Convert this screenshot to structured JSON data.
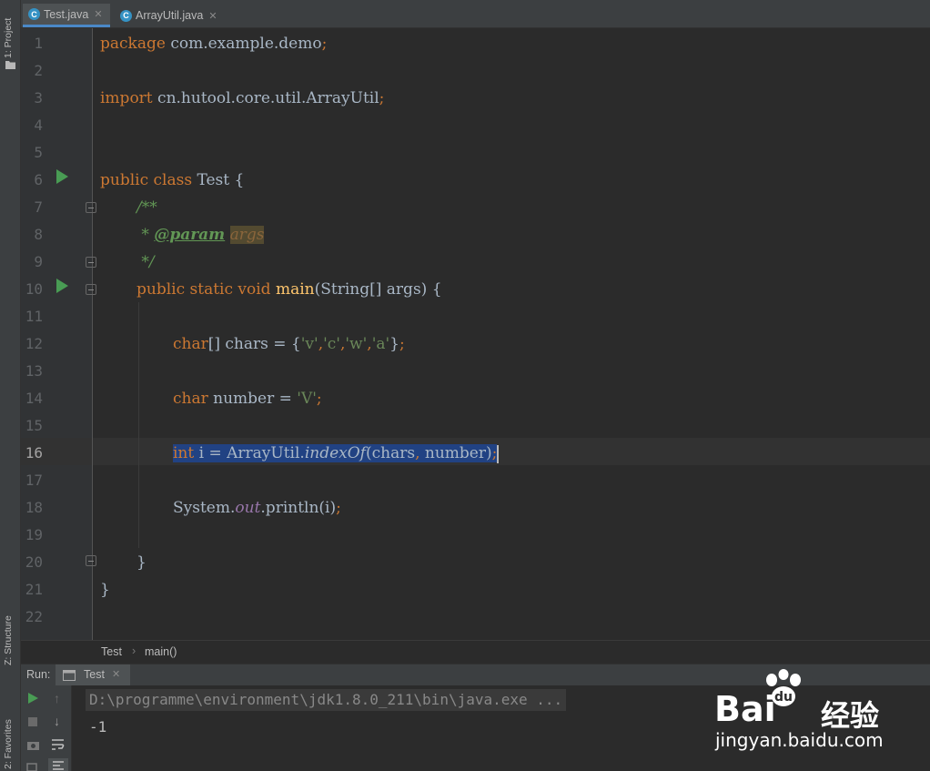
{
  "sidebar": {
    "project_tab": "1: Project",
    "structure_tab": "Z: Structure",
    "favorites_tab": "2: Favorites"
  },
  "tabs": [
    {
      "label": "Test.java",
      "icon": "java-class-icon",
      "active": true
    },
    {
      "label": "ArrayUtil.java",
      "icon": "java-class-icon",
      "active": false
    }
  ],
  "editor": {
    "line_numbers": [
      "1",
      "2",
      "3",
      "4",
      "5",
      "6",
      "7",
      "8",
      "9",
      "10",
      "11",
      "12",
      "13",
      "14",
      "15",
      "16",
      "17",
      "18",
      "19",
      "20",
      "21",
      "22"
    ],
    "current_line": 16,
    "code": {
      "l1_kw": "package",
      "l1_rest": " com.example.demo",
      "l1_semi": ";",
      "l3_kw": "import",
      "l3_rest": " cn.hutool.core.util.ArrayUtil",
      "l3_semi": ";",
      "l6_kw": "public class",
      "l6_rest": " Test {",
      "l7": "/**",
      "l8_star": " * ",
      "l8_tag": "@param",
      "l8_sp": " ",
      "l8_param": "args",
      "l9": " */",
      "l10_kw": "public static void",
      "l10_sp": " ",
      "l10_fn": "main",
      "l10_rest": "(String[] args) {",
      "l12_kw": "char",
      "l12_a": "[] chars = {",
      "l12_s1": "'v'",
      "l12_c1": ",",
      "l12_s2": "'c'",
      "l12_c2": ",",
      "l12_s3": "'w'",
      "l12_c3": ",",
      "l12_s4": "'a'",
      "l12_end": "}",
      "l12_semi": ";",
      "l14_kw": "char",
      "l14_a": " number = ",
      "l14_s": "'V'",
      "l14_semi": ";",
      "l16_kw": "int",
      "l16_a": " i = ArrayUtil.",
      "l16_m": "indexOf",
      "l16_b": "(chars",
      "l16_comma": ",",
      "l16_c": " number)",
      "l16_semi": ";",
      "l18_a": "System.",
      "l18_field": "out",
      "l18_b": ".println(i)",
      "l18_semi": ";",
      "l20": "}",
      "l21": "}"
    }
  },
  "breadcrumb": [
    "Test",
    "main()"
  ],
  "run_panel": {
    "label": "Run:",
    "tab": "Test",
    "console_lines": [
      "D:\\programme\\environment\\jdk1.8.0_211\\bin\\java.exe ...",
      "-1"
    ]
  },
  "watermark": {
    "brand_left": "Bai",
    "brand_right": "经验",
    "url": "jingyan.baidu.com"
  },
  "colors": {
    "keyword": "#cc7832",
    "string": "#6a8759",
    "doc": "#629755",
    "function": "#ffc66d",
    "field": "#9876aa",
    "selection": "#214283",
    "background": "#2b2b2b"
  }
}
